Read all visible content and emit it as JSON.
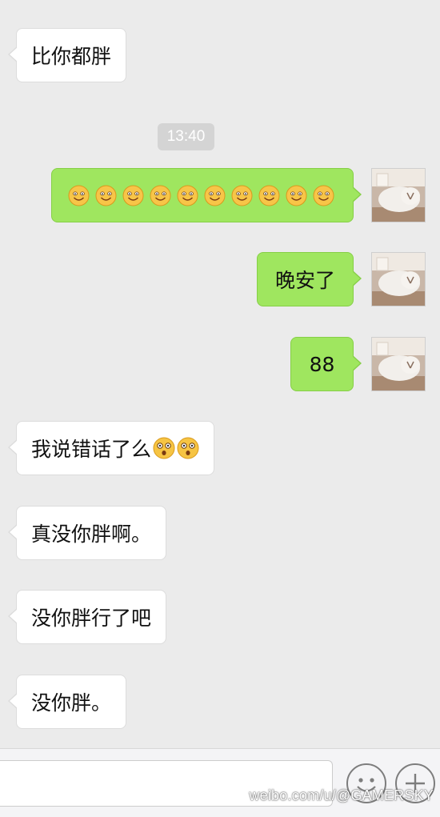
{
  "timestamp": "13:40",
  "messages": [
    {
      "side": "in",
      "text": "比你都胖"
    },
    {
      "side": "out",
      "text": ""
    },
    {
      "side": "out",
      "text": "晚安了"
    },
    {
      "side": "out",
      "text": "88"
    },
    {
      "side": "in",
      "text": "我说错话了么"
    },
    {
      "side": "in",
      "text": "真没你胖啊。"
    },
    {
      "side": "in",
      "text": "没你胖行了吧"
    },
    {
      "side": "in",
      "text": "没你胖。"
    }
  ],
  "emoji": {
    "smile_count": 10,
    "smile_icon": "smile-emoji",
    "shock_icon": "shocked-emoji"
  },
  "input": {
    "placeholder": ""
  },
  "watermark": "weibo.com/u/@GAMERSKY",
  "colors": {
    "background": "#ebebeb",
    "outgoing_bubble": "#9fe65f",
    "incoming_bubble": "#ffffff"
  }
}
